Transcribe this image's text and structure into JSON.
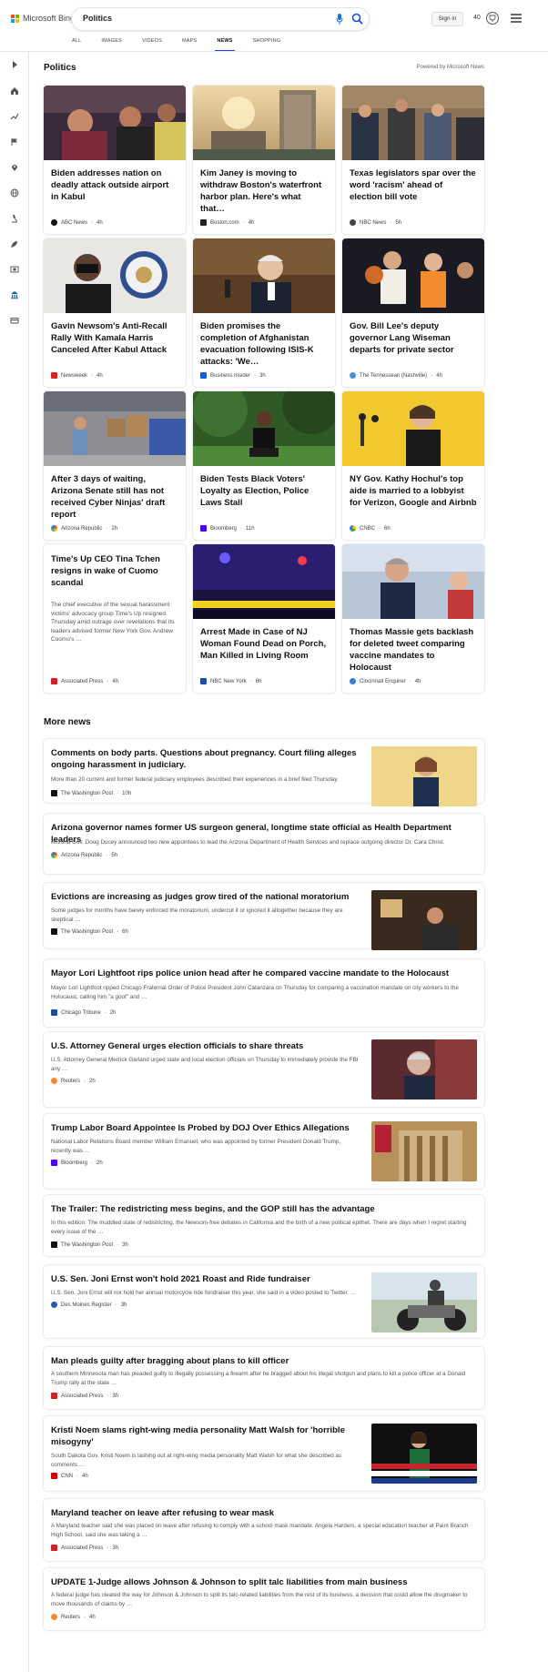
{
  "brand": "Microsoft Bing",
  "search": {
    "query": "Politics"
  },
  "header": {
    "sign_in": "Sign in",
    "points": "40"
  },
  "tabs": [
    "ALL",
    "IMAGES",
    "VIDEOS",
    "MAPS",
    "NEWS",
    "SHOPPING"
  ],
  "active_tab": "NEWS",
  "section": {
    "title": "Politics",
    "powered": "Powered by Microsoft News"
  },
  "cards": [
    {
      "title": "Biden addresses nation on deadly attack outside airport in Kabul",
      "source": "ABC News",
      "time": "4h",
      "src_color": "#111111"
    },
    {
      "title": "Kim Janey is moving to withdraw Boston's waterfront harbor plan. Here's what that…",
      "source": "Boston.com",
      "time": "4h",
      "src_color": "#222222"
    },
    {
      "title": "Texas legislators spar over the word 'racism' ahead of election bill vote",
      "source": "NBC News",
      "time": "5h",
      "src_color": "#444444"
    },
    {
      "title": "Gavin Newsom's Anti-Recall Rally With Kamala Harris Canceled After Kabul Attack",
      "source": "Newsweek",
      "time": "4h",
      "src_color": "#e0231b"
    },
    {
      "title": "Biden promises the completion of Afghanistan evacuation following ISIS-K attacks: 'We…",
      "source": "Business Insider",
      "time": "3h",
      "src_color": "#1b5ad6"
    },
    {
      "title": "Gov. Bill Lee's deputy governor Lang Wiseman departs for private sector",
      "source": "The Tennessean (Nashville)",
      "time": "4h",
      "src_color": "#4a90d9"
    },
    {
      "title": "After 3 days of waiting, Arizona Senate still has not received Cyber Ninjas' draft report",
      "source": "Arizona Republic",
      "time": "2h",
      "src_color": "#4a8fd6"
    },
    {
      "title": "Biden Tests Black Voters' Loyalty as Election, Police Laws Stall",
      "source": "Bloomberg",
      "time": "11h",
      "src_color": "#4b00ff"
    },
    {
      "title": "NY Gov. Kathy Hochul's top aide is married to a lobbyist for Verizon, Google and Airbnb",
      "source": "CNBC",
      "time": "6h",
      "src_color": "#2a7de1"
    },
    {
      "title": "Time's Up CEO Tina Tchen resigns in wake of Cuomo scandal",
      "snippet": "The chief executive of the sexual harassment victims' advocacy group Time's Up resigned Thursday amid outrage over revelations that its leaders advised former New York Gov. Andrew Cuomo's …",
      "source": "Associated Press",
      "time": "4h",
      "src_color": "#d31f26"
    },
    {
      "title": "Arrest Made in Case of NJ Woman Found Dead on Porch, Man Killed in Living Room",
      "source": "NBC New York",
      "time": "6h",
      "src_color": "#1a4fa0"
    },
    {
      "title": "Thomas Massie gets backlash for deleted tweet comparing vaccine mandates to Holocaust",
      "source": "Cincinnati Enquirer",
      "time": "4h",
      "src_color": "#3a7bd5"
    }
  ],
  "more_news": {
    "title": "More news",
    "items": [
      {
        "title": "Comments on body parts. Questions about pregnancy. Court filing alleges ongoing harassment in judiciary.",
        "snippet": "More than 20 current and former federal judiciary employees described their experiences in a brief filed Thursday.",
        "source": "The Washington Post",
        "time": "10h",
        "src_color": "#111111"
      },
      {
        "title": "Arizona governor names former US surgeon general, longtime state official as Health Department leaders",
        "snippet": "Arizona Gov. Doug Ducey announced two new appointees to lead the Arizona Department of Health Services and replace outgoing director Dr. Cara Christ.",
        "source": "Arizona Republic",
        "time": "5h",
        "src_color": "#4a8fd6"
      },
      {
        "title": "Evictions are increasing as judges grow tired of the national moratorium",
        "snippet": "Some judges for months have barely enforced the moratorium, undercut it or ignored it altogether because they are skeptical …",
        "source": "The Washington Post",
        "time": "6h",
        "src_color": "#111111"
      },
      {
        "title": "Mayor Lori Lightfoot rips police union head after he compared vaccine mandate to the Holocaust",
        "snippet": "Mayor Lori Lightfoot ripped Chicago Fraternal Order of Police President John Catanzara on Thursday for comparing a vaccination mandate on city workers to the Holocaust, calling him \"a goof\" and …",
        "source": "Chicago Tribune",
        "time": "2h",
        "src_color": "#1a4fa0"
      },
      {
        "title": "U.S. Attorney General urges election officials to share threats",
        "snippet": "U.S. Attorney General Merrick Garland urged state and local election officials on Thursday to immediately provide the FBI any …",
        "source": "Reuters",
        "time": "2h",
        "src_color": "#f28a2e"
      },
      {
        "title": "Trump Labor Board Appointee Is Probed by DOJ Over Ethics Allegations",
        "snippet": "National Labor Relations Board member William Emanuel, who was appointed by former President Donald Trump, recently was …",
        "source": "Bloomberg",
        "time": "2h",
        "src_color": "#4b00ff"
      },
      {
        "title": "The Trailer: The redistricting mess begins, and the GOP still has the advantage",
        "snippet": "In this edition: The muddled state of redistricting, the Newsom-free debates in California and the birth of a new political epithet. There are days when I regret starting every issue of the …",
        "source": "The Washington Post",
        "time": "3h",
        "src_color": "#111111"
      },
      {
        "title": "U.S. Sen. Joni Ernst won't hold 2021 Roast and Ride fundraiser",
        "snippet": "U.S. Sen. Joni Ernst will not hold her annual motorcycle ride fundraiser this year, she said in a video posted to Twitter. …",
        "source": "Des Moines Register",
        "time": "3h",
        "src_color": "#2856b6"
      },
      {
        "title": "Man pleads guilty after bragging about plans to kill officer",
        "snippet": "A southern Minnesota man has pleaded guilty to illegally possessing a firearm after he bragged about his illegal shotgun and plans to kill a police officer at a Donald Trump rally at the state …",
        "source": "Associated Press",
        "time": "3h",
        "src_color": "#d31f26"
      },
      {
        "title": "Kristi Noem slams right-wing media personality Matt Walsh for 'horrible misogyny'",
        "snippet": "South Dakota Gov. Kristi Noem is lashing out at right-wing media personality Matt Walsh for what she described as comments …",
        "source": "CNN",
        "time": "4h",
        "src_color": "#cc0000"
      },
      {
        "title": "Maryland teacher on leave after refusing to wear mask",
        "snippet": "A Maryland teacher said she was placed on leave after refusing to comply with a school mask mandate. Angela Harders, a special education teacher at Paint Branch High School, said she was taking a …",
        "source": "Associated Press",
        "time": "3h",
        "src_color": "#d31f26"
      },
      {
        "title": "UPDATE 1-Judge allows Johnson & Johnson to split talc liabilities from main business",
        "snippet": "A federal judge has cleared the way for Johnson & Johnson to split its talc-related liabilities from the rest of its business, a decision that could allow the drugmaker to move thousands of claims by …",
        "source": "Reuters",
        "time": "4h",
        "src_color": "#f28a2e"
      }
    ]
  }
}
